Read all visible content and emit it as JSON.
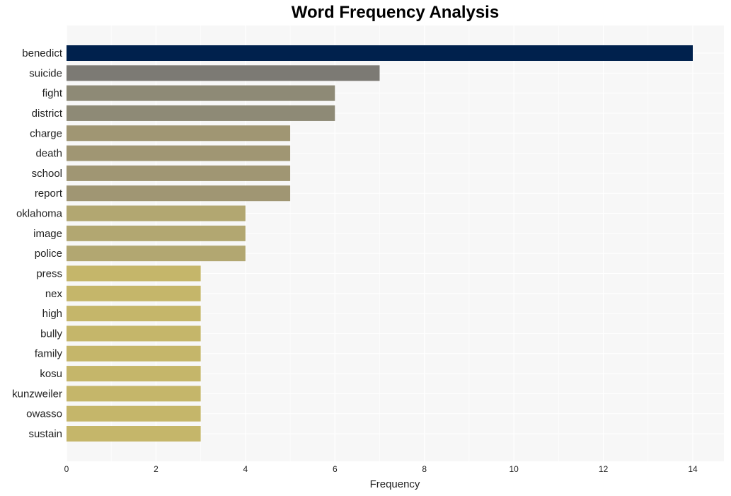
{
  "chart_data": {
    "type": "bar",
    "orientation": "horizontal",
    "title": "Word Frequency Analysis",
    "xlabel": "Frequency",
    "ylabel": "",
    "xlim": [
      0,
      14.7
    ],
    "xticks": [
      0,
      2,
      4,
      6,
      8,
      10,
      12,
      14
    ],
    "grid": true,
    "categories": [
      "benedict",
      "suicide",
      "fight",
      "district",
      "charge",
      "death",
      "school",
      "report",
      "oklahoma",
      "image",
      "police",
      "press",
      "nex",
      "high",
      "bully",
      "family",
      "kosu",
      "kunzweiler",
      "owasso",
      "sustain"
    ],
    "values": [
      14,
      7,
      6,
      6,
      5,
      5,
      5,
      5,
      4,
      4,
      4,
      3,
      3,
      3,
      3,
      3,
      3,
      3,
      3,
      3
    ],
    "colors": [
      "#00214d",
      "#7c7a74",
      "#8e8a76",
      "#8e8a76",
      "#a09673",
      "#a09673",
      "#a09673",
      "#a09673",
      "#b2a771",
      "#b2a771",
      "#b2a771",
      "#c5b66a",
      "#c5b66a",
      "#c5b66a",
      "#c5b66a",
      "#c5b66a",
      "#c5b66a",
      "#c5b66a",
      "#c5b66a",
      "#c5b66a"
    ]
  },
  "colors": {
    "plot_background": "#f7f7f7",
    "grid": "#ffffff"
  }
}
